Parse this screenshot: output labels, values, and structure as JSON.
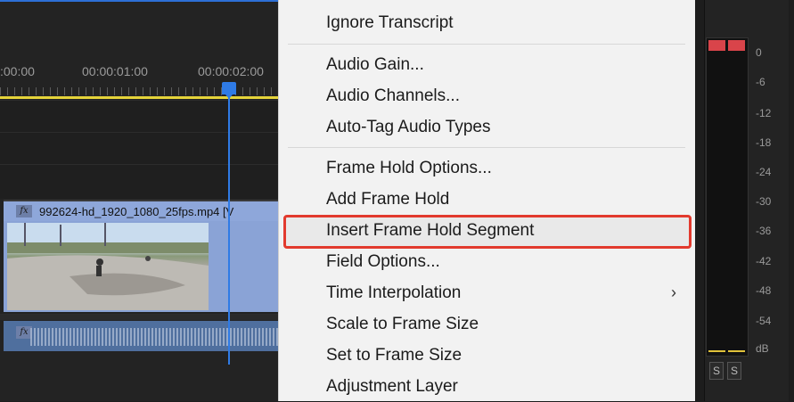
{
  "timeline": {
    "timecodes": [
      ":00:00",
      "00:00:01:00",
      "00:00:02:00"
    ],
    "video_clip": {
      "fx": "fx",
      "name": "992624-hd_1920_1080_25fps.mp4 [V"
    },
    "audio_clip": {
      "fx": "fx"
    }
  },
  "context_menu": {
    "highlighted_item": "Insert Frame Hold Segment",
    "groups": [
      [
        "Ignore Transcript"
      ],
      [
        "Audio Gain...",
        "Audio Channels...",
        "Auto-Tag Audio Types"
      ],
      [
        "Frame Hold Options...",
        "Add Frame Hold",
        "Insert Frame Hold Segment",
        "Field Options...",
        "Time Interpolation",
        "Scale to Frame Size",
        "Set to Frame Size",
        "Adjustment Layer"
      ]
    ],
    "submenu_items": [
      "Time Interpolation"
    ]
  },
  "audio_meter": {
    "db_labels": [
      "0",
      "-6",
      "-12",
      "-18",
      "-24",
      "-30",
      "-36",
      "-42",
      "-48",
      "-54",
      "dB"
    ],
    "solo_buttons": [
      "S",
      "S"
    ],
    "colors": {
      "peak": "#d9444a",
      "level": "#e0c23a"
    }
  },
  "colors": {
    "highlight_border": "#e23a2e",
    "playhead": "#2f7be6",
    "video_clip": "#8aa3d6"
  }
}
